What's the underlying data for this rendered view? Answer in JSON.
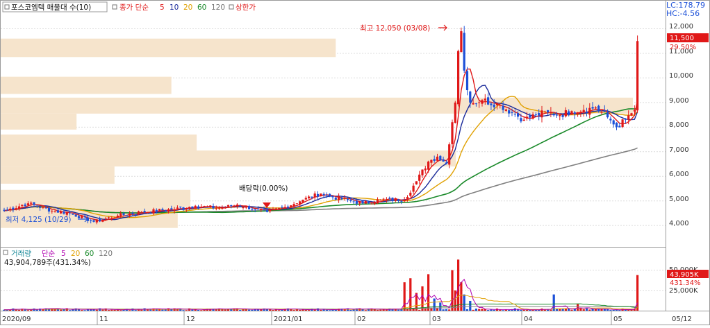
{
  "legend": {
    "title": "포스코엠텍 매물대 수(10)",
    "ma_label": "종가 단순",
    "periods": [
      "5",
      "10",
      "20",
      "60",
      "120"
    ],
    "limit_label": "상한가"
  },
  "info": {
    "lc": "LC:178.79",
    "hc": "HC:-4.56"
  },
  "price_axis": {
    "ticks": [
      "12,000",
      "11,000",
      "10,000",
      "9,000",
      "8,000",
      "7,000",
      "6,000",
      "5,000",
      "4,000"
    ],
    "current_price": "11,500",
    "current_change": "29.50%"
  },
  "annotations": {
    "high": "최고 12,050 (03/08)",
    "low": "최저 4,125 (10/29)",
    "dividend": "배당락(0.00%)"
  },
  "volume": {
    "title": "거래량",
    "ma_label": "단순",
    "periods": [
      "5",
      "20",
      "60",
      "120"
    ],
    "value_text": "43,904,789주(431.34%)",
    "ticks": [
      "50,000K",
      "25,000K"
    ],
    "current_volume": "43,905K",
    "current_change": "431.34%"
  },
  "date_axis": {
    "labels": [
      "2020/09",
      "11",
      "12",
      "2021/01",
      "02",
      "03",
      "04",
      "05",
      "05/12"
    ]
  },
  "colors": {
    "up": "#e01818",
    "down": "#1c50d8",
    "ma5": "#e01818",
    "ma10": "#1a2a9a",
    "ma20": "#e0a000",
    "ma60": "#1a8a2a",
    "ma120": "#808080",
    "profile": "#f6e4cc",
    "vol_ma5": "#b000b0"
  },
  "chart_data": {
    "type": "candlestick",
    "price_range": [
      3300,
      12550
    ],
    "volume_max_k": 65000,
    "limit_up_close": 11500,
    "volume_profile": [
      {
        "price_low": 10850,
        "price_high": 11600,
        "weight": 0.53
      },
      {
        "price_low": 9350,
        "price_high": 10050,
        "weight": 0.27
      },
      {
        "price_low": 8550,
        "price_high": 9200,
        "weight": 1.0
      },
      {
        "price_low": 7900,
        "price_high": 8550,
        "weight": 0.12
      },
      {
        "price_low": 7050,
        "price_high": 7700,
        "weight": 0.31
      },
      {
        "price_low": 6400,
        "price_high": 7050,
        "weight": 0.72
      },
      {
        "price_low": 5700,
        "price_high": 6400,
        "weight": 0.18
      },
      {
        "price_low": 4750,
        "price_high": 5450,
        "weight": 0.3
      },
      {
        "price_low": 3900,
        "price_high": 4750,
        "weight": 0.28
      }
    ],
    "price_key_points": [
      [
        0,
        4600
      ],
      [
        8,
        4900
      ],
      [
        16,
        4600
      ],
      [
        22,
        4500
      ],
      [
        30,
        4150
      ],
      [
        38,
        4400
      ],
      [
        46,
        4550
      ],
      [
        56,
        4650
      ],
      [
        64,
        4800
      ],
      [
        72,
        4700
      ],
      [
        78,
        4850
      ],
      [
        84,
        4650
      ],
      [
        88,
        4550
      ],
      [
        94,
        4750
      ],
      [
        100,
        5050
      ],
      [
        106,
        5300
      ],
      [
        110,
        5150
      ],
      [
        116,
        5000
      ],
      [
        120,
        4900
      ],
      [
        126,
        5050
      ],
      [
        134,
        5050
      ],
      [
        138,
        5800
      ],
      [
        142,
        6600
      ],
      [
        145,
        6800
      ],
      [
        148,
        6500
      ],
      [
        149,
        7300
      ],
      [
        150,
        8200
      ],
      [
        151,
        9000
      ],
      [
        152,
        11100
      ],
      [
        153,
        11900
      ],
      [
        154,
        10300
      ],
      [
        156,
        9000
      ],
      [
        160,
        9100
      ],
      [
        166,
        8900
      ],
      [
        170,
        8600
      ],
      [
        174,
        8300
      ],
      [
        178,
        8500
      ],
      [
        182,
        8600
      ],
      [
        186,
        8500
      ],
      [
        190,
        8650
      ],
      [
        194,
        8700
      ],
      [
        198,
        8800
      ],
      [
        202,
        8400
      ],
      [
        205,
        8000
      ],
      [
        208,
        8300
      ],
      [
        211,
        8700
      ],
      [
        212,
        11500
      ]
    ],
    "volume_spikes": [
      {
        "day": 134,
        "v": 35000
      },
      {
        "day": 136,
        "v": 40000
      },
      {
        "day": 138,
        "v": 22000
      },
      {
        "day": 140,
        "v": 30000
      },
      {
        "day": 142,
        "v": 45000
      },
      {
        "day": 144,
        "v": 15000
      },
      {
        "day": 146,
        "v": 10000
      },
      {
        "day": 150,
        "v": 50000
      },
      {
        "day": 151,
        "v": 25000
      },
      {
        "day": 152,
        "v": 63000
      },
      {
        "day": 153,
        "v": 35000
      },
      {
        "day": 154,
        "v": 20000
      },
      {
        "day": 156,
        "v": 12000
      },
      {
        "day": 184,
        "v": 20000
      },
      {
        "day": 192,
        "v": 8000
      },
      {
        "day": 212,
        "v": 43905
      }
    ]
  }
}
